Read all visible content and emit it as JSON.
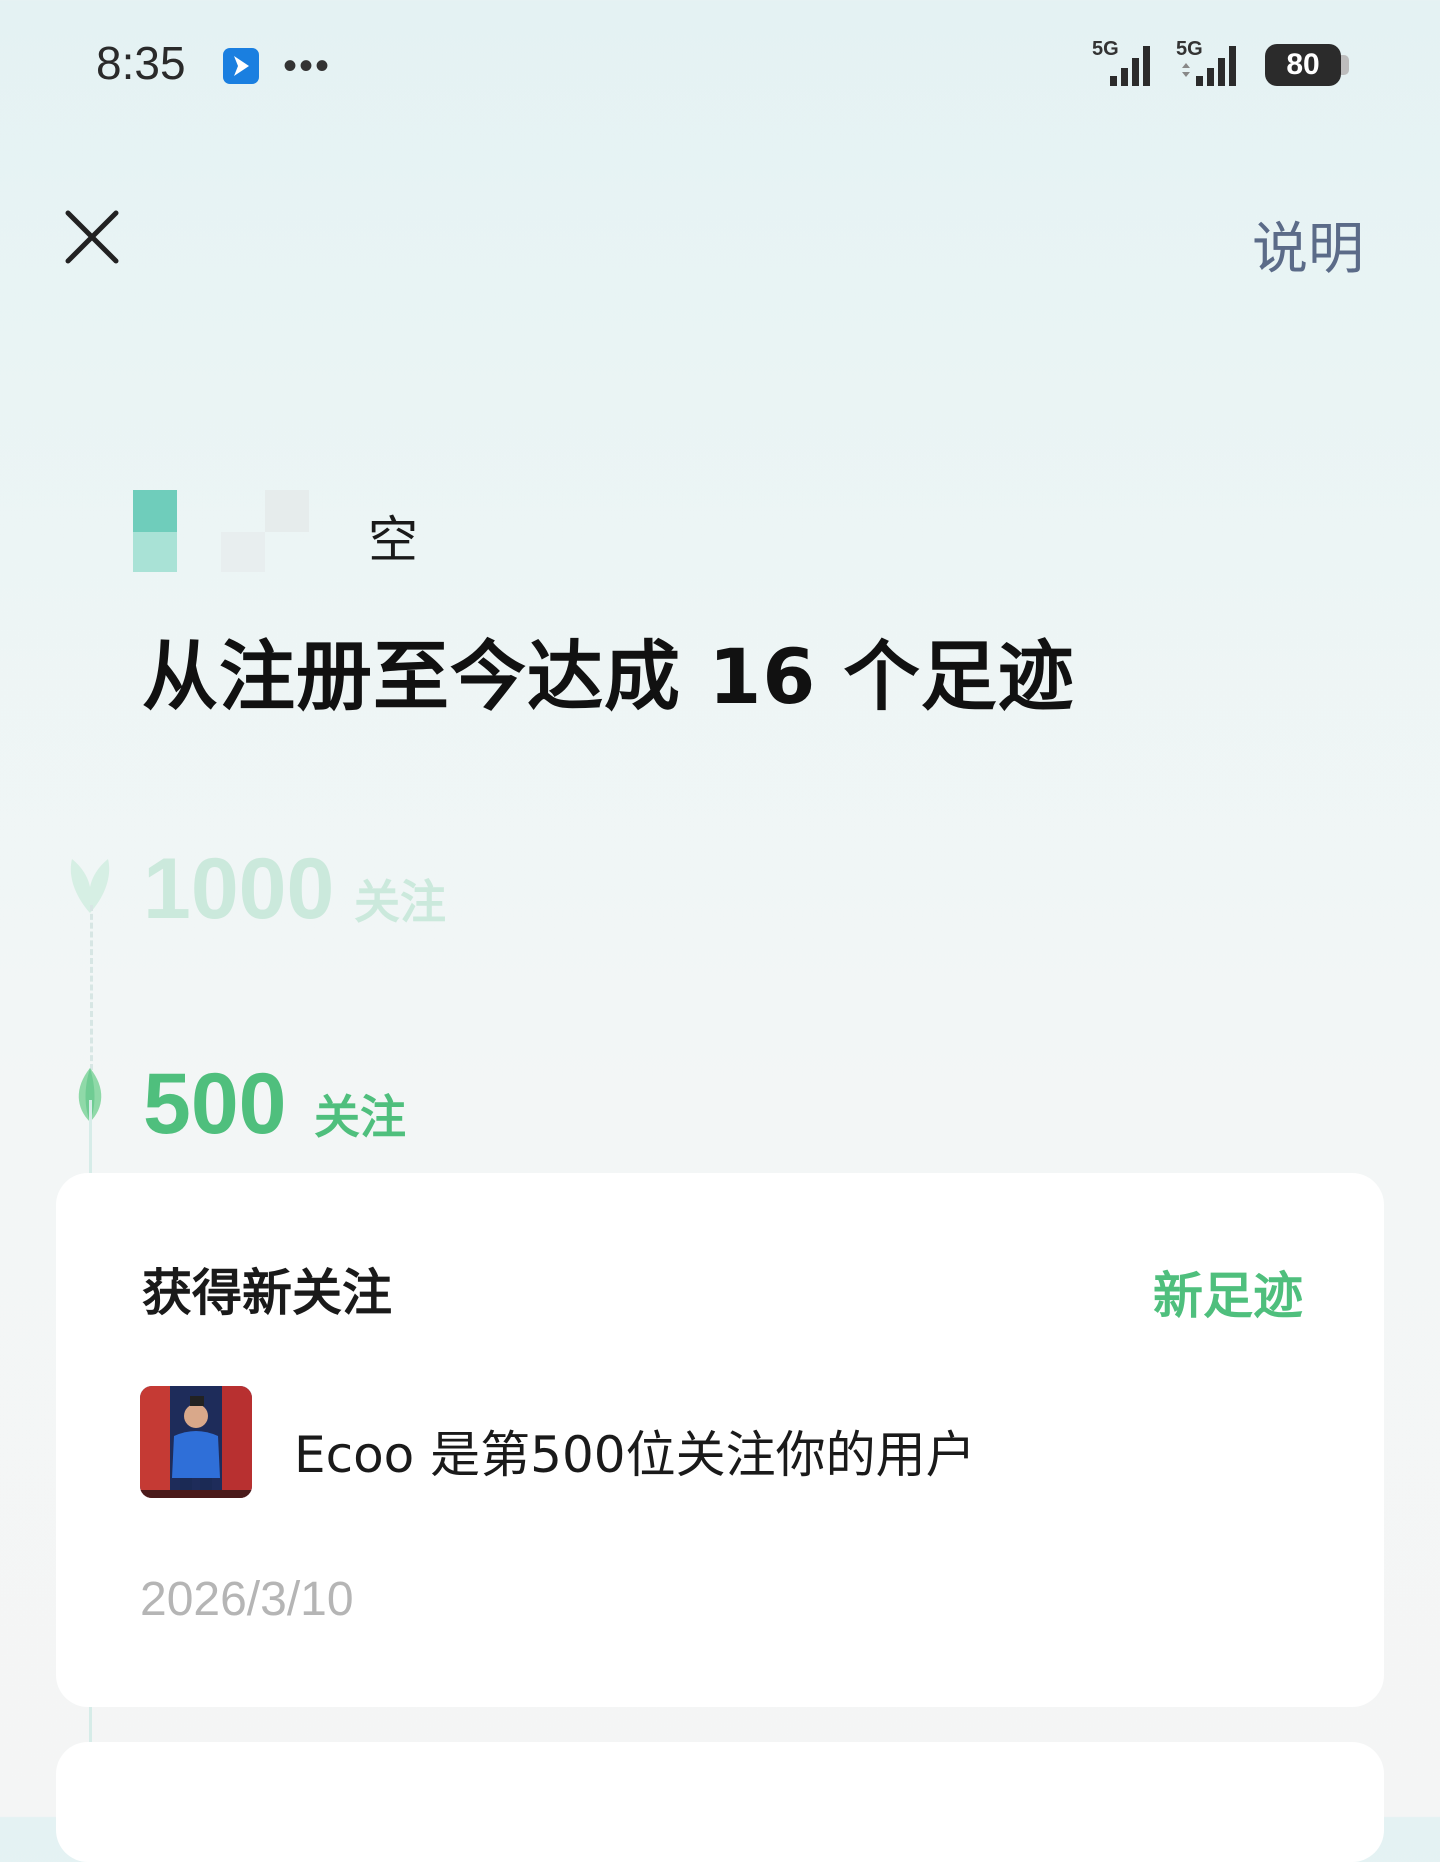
{
  "status_bar": {
    "time": "8:35",
    "more": "•••",
    "sim1_label": "5G",
    "sim2_label": "5G",
    "battery": "80"
  },
  "header": {
    "explain_label": "说明"
  },
  "user": {
    "name_visible": "空"
  },
  "headline": "从注册至今达成 16 个足迹",
  "milestones": [
    {
      "number": "1000",
      "unit": "关注",
      "reached": false
    },
    {
      "number": "500",
      "unit": "关注",
      "reached": true
    }
  ],
  "card": {
    "title": "获得新关注",
    "badge": "新足迹",
    "follow_text": "Ecoo 是第500位关注你的用户",
    "date": "2026/3/10"
  },
  "colors": {
    "accent_green": "#4fbf7d",
    "faded_green": "#cbe9dc",
    "link_blue_gray": "#5b6b88"
  }
}
